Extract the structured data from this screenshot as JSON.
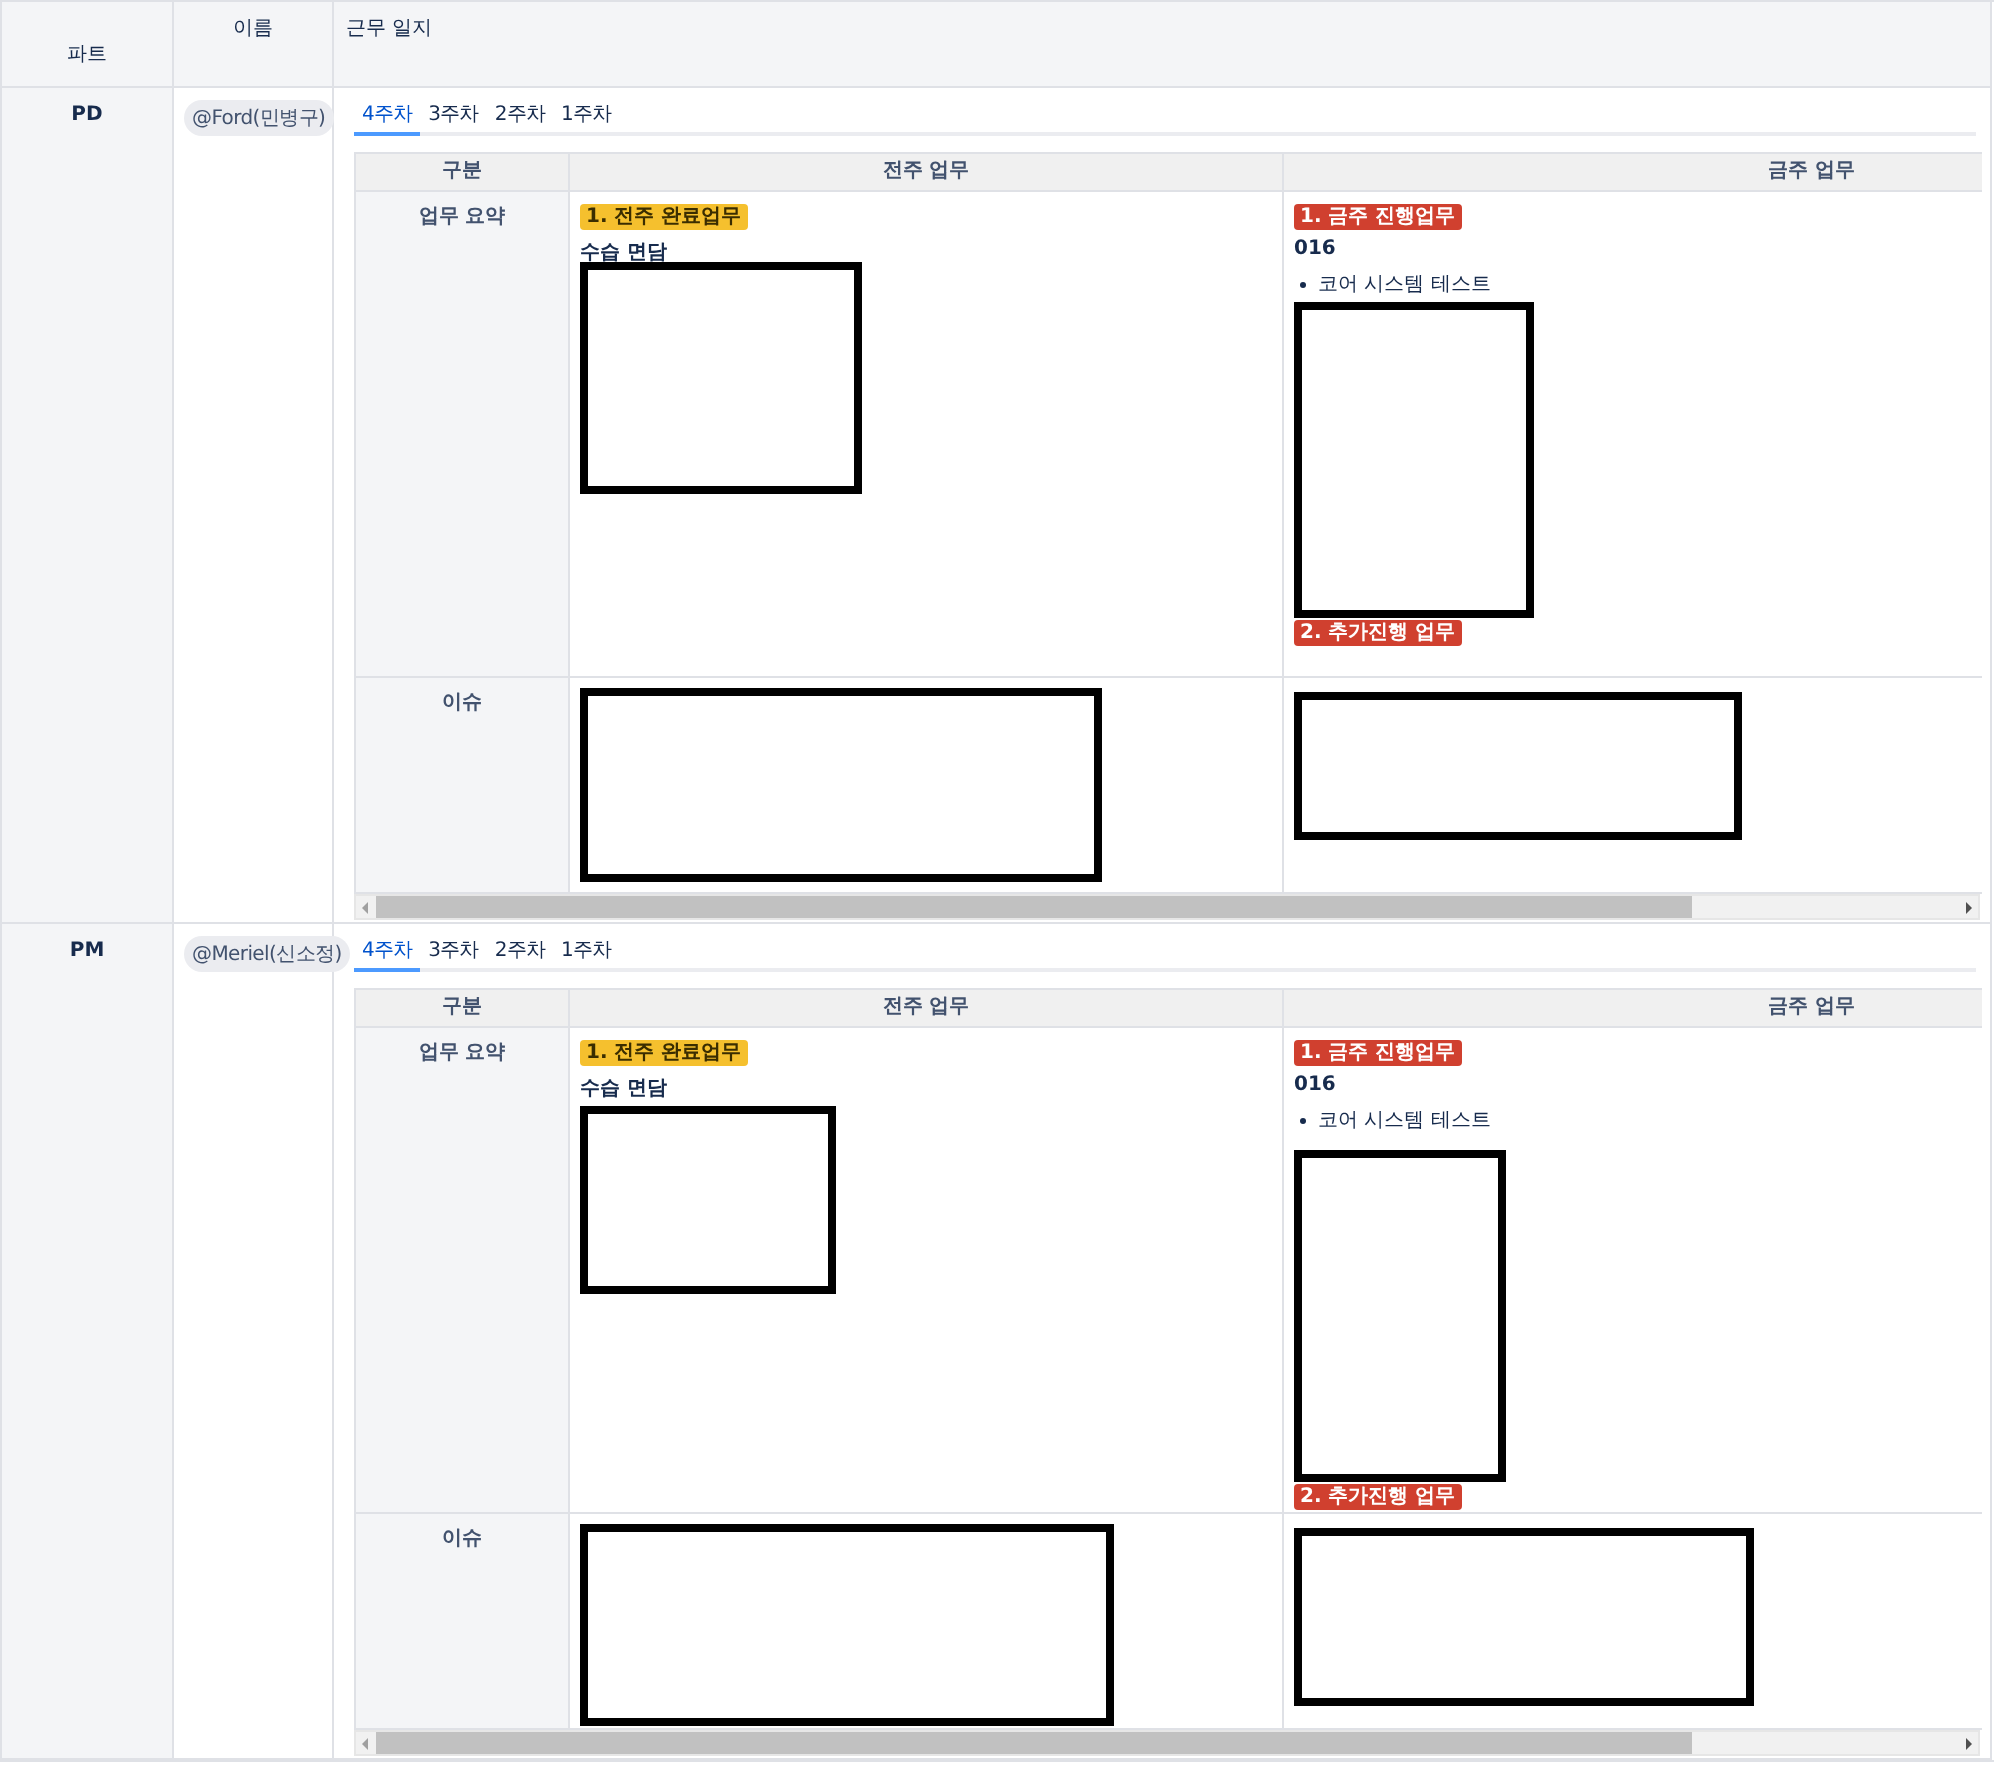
{
  "header": {
    "columns": [
      "파트",
      "이름",
      "근무 일지"
    ]
  },
  "rows": [
    {
      "part": "PD",
      "name": "@Ford(민병구)",
      "tabs": [
        {
          "label": "4주차",
          "selected": true
        },
        {
          "label": "3주차",
          "selected": false
        },
        {
          "label": "2주차",
          "selected": false
        },
        {
          "label": "1주차",
          "selected": false
        }
      ],
      "log": {
        "columns": [
          "구분",
          "전주 업무",
          "금주 업무"
        ],
        "rows": [
          {
            "label": "업무 요약",
            "prev": [
              {
                "kind": "tag",
                "text": "1. 전주 완료업무",
                "color": "#f5c02e"
              },
              {
                "kind": "text",
                "text": "수습 면담"
              },
              {
                "kind": "redacted"
              }
            ],
            "curr": [
              {
                "kind": "tag",
                "text": "1. 금주 진행업무",
                "color": "#d0402f"
              },
              {
                "kind": "text",
                "text": "016"
              },
              {
                "kind": "bullet",
                "text": "코어 시스템 테스트"
              },
              {
                "kind": "redacted"
              },
              {
                "kind": "tag",
                "text": "2. 추가진행 업무",
                "color": "#d0402f"
              }
            ]
          },
          {
            "label": "이슈",
            "prev": [
              {
                "kind": "redacted"
              }
            ],
            "curr": [
              {
                "kind": "redacted"
              }
            ]
          }
        ]
      }
    },
    {
      "part": "PM",
      "name": "@Meriel(신소정)",
      "tabs": [
        {
          "label": "4주차",
          "selected": true
        },
        {
          "label": "3주차",
          "selected": false
        },
        {
          "label": "2주차",
          "selected": false
        },
        {
          "label": "1주차",
          "selected": false
        }
      ],
      "log": {
        "columns": [
          "구분",
          "전주 업무",
          "금주 업무"
        ],
        "rows": [
          {
            "label": "업무 요약",
            "prev": [
              {
                "kind": "tag",
                "text": "1. 전주 완료업무",
                "color": "#f5c02e"
              },
              {
                "kind": "text",
                "text": "수습 면담"
              },
              {
                "kind": "redacted"
              }
            ],
            "curr": [
              {
                "kind": "tag",
                "text": "1. 금주 진행업무",
                "color": "#d0402f"
              },
              {
                "kind": "text",
                "text": "016"
              },
              {
                "kind": "bullet",
                "text": "코어 시스템 테스트"
              },
              {
                "kind": "redacted"
              },
              {
                "kind": "tag",
                "text": "2. 추가진행 업무",
                "color": "#d0402f"
              }
            ]
          },
          {
            "label": "이슈",
            "prev": [
              {
                "kind": "redacted"
              }
            ],
            "curr": [
              {
                "kind": "redacted"
              }
            ]
          }
        ]
      }
    }
  ]
}
